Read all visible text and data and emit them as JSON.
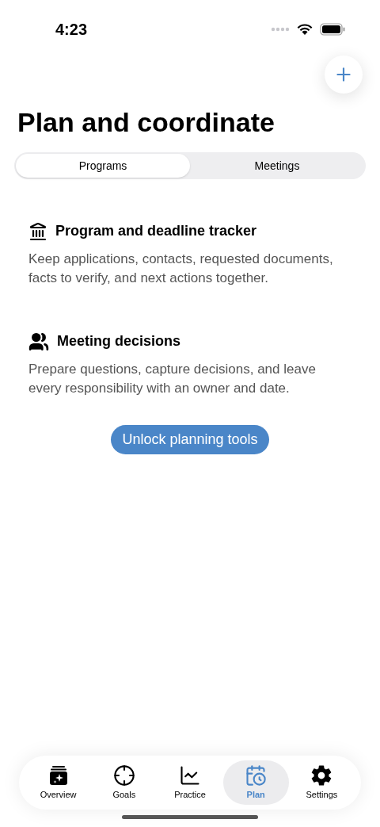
{
  "status_bar": {
    "time": "4:23"
  },
  "title": "Plan and coordinate",
  "segments": [
    {
      "label": "Programs",
      "selected": true
    },
    {
      "label": "Meetings",
      "selected": false
    }
  ],
  "sections": [
    {
      "title": "Program and deadline tracker",
      "body": "Keep applications, contacts, requested documents, facts to verify, and next actions together."
    },
    {
      "title": "Meeting decisions",
      "body": "Prepare questions, capture decisions, and leave every responsibility with an owner and date."
    }
  ],
  "unlock_button": "Unlock planning tools",
  "tab_bar": [
    {
      "label": "Overview",
      "selected": false
    },
    {
      "label": "Goals",
      "selected": false
    },
    {
      "label": "Practice",
      "selected": false
    },
    {
      "label": "Plan",
      "selected": true
    },
    {
      "label": "Settings",
      "selected": false
    }
  ]
}
